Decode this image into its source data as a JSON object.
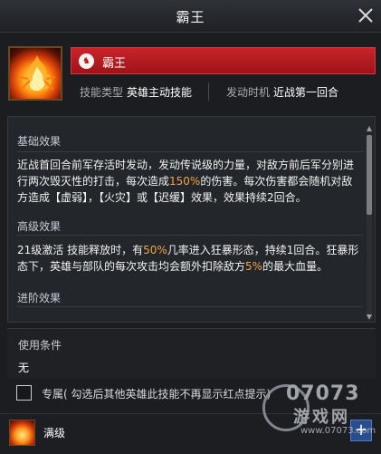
{
  "window": {
    "title": "霸王"
  },
  "skill": {
    "name": "霸王",
    "badge_glyph": "♞",
    "type_label": "技能类型",
    "type_value": "英雄主动技能",
    "trigger_label": "发动时机",
    "trigger_value": "近战第一回合"
  },
  "sections": {
    "basic": {
      "title": "基础效果",
      "p1": "近战首回合前军存活时发动，发动传说级的力量，对敌方前后军分别进行两次毁灭性的打击，每次造成",
      "p1_hl": "150%",
      "p1_rest": "的伤害。每次伤害都会随机对敌方造成【虚弱】，【火灾】或【迟缓】效果，效果持续2回合。"
    },
    "advanced": {
      "title": "高级效果",
      "p1": "21级激活 技能释放时，有",
      "hl1": "50%",
      "p2": "几率进入狂暴形态，持续1回合。狂暴形态下，英雄与部队的每次攻击均会额外扣除敌方",
      "hl2": "5%",
      "p3": "的最大血量。"
    },
    "advance": {
      "title": "进阶效果"
    }
  },
  "conditions": {
    "label": "使用条件",
    "value": "无"
  },
  "exclusive": {
    "label": "专属( 勾选后其他英雄此技能不再显示红点提示)"
  },
  "footer": {
    "level_text": "满级",
    "plus_label": "+"
  },
  "watermark": {
    "big": "07073",
    "cn": "游戏网",
    "url": "www.07073.com"
  },
  "colors": {
    "accent_red": "#c8242a",
    "highlight": "#f0a645",
    "background": "#1b1d21"
  }
}
